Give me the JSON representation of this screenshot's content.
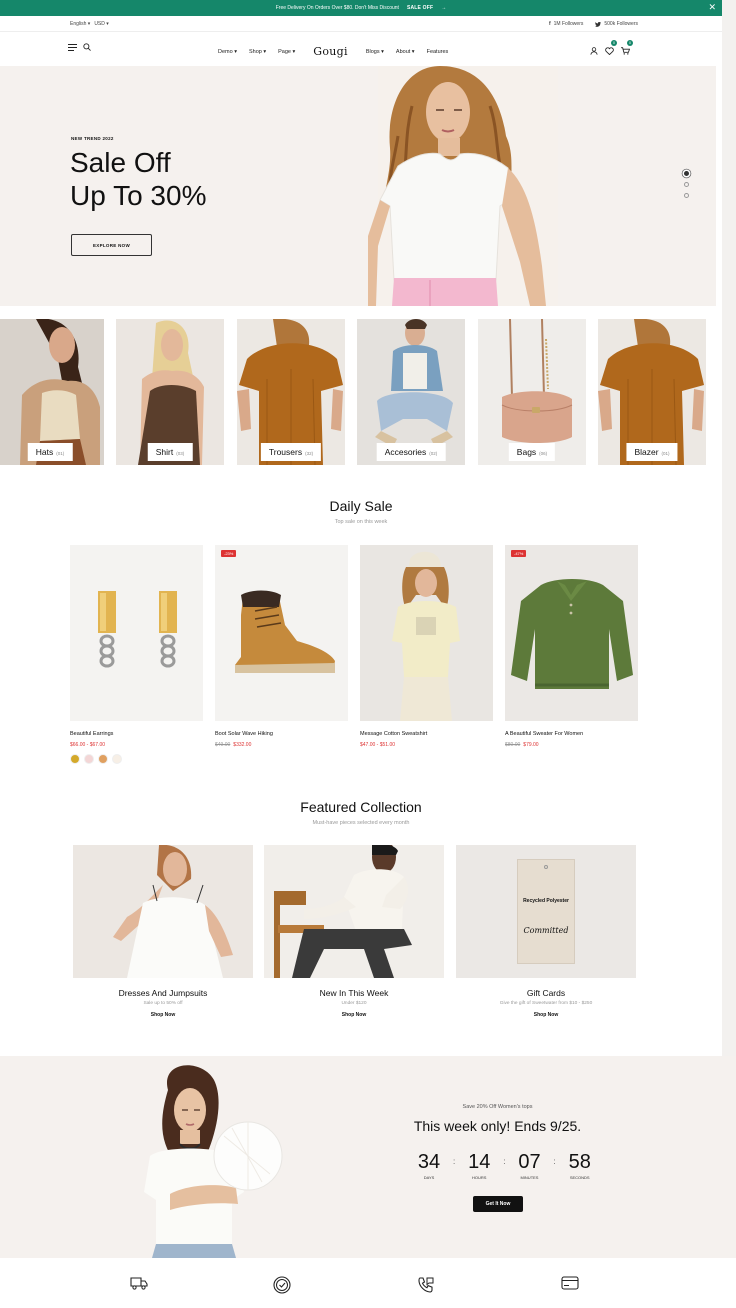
{
  "announcement": {
    "text": "Free Delivery On Orders Over $80. Don't Miss Discount",
    "cta": "SALE OFF",
    "arrow": "→",
    "close": "✕"
  },
  "topbar": {
    "language": "English",
    "currency": "USD",
    "facebook": "1M Followers",
    "twitter": "500k Followers"
  },
  "nav": {
    "logo": "Gougi",
    "menu": [
      "Demo",
      "Shop",
      "Page",
      "Blogs",
      "About",
      "Features"
    ],
    "wishlist_count": "0",
    "cart_count": "0"
  },
  "hero": {
    "eyebrow": "NEW TREND 2022",
    "line1": "Sale Off",
    "line2": "Up To 30%",
    "button": "EXPLORE NOW",
    "slides": 3,
    "active_slide": 1
  },
  "categories": [
    {
      "name": "Hats",
      "count": "(01)"
    },
    {
      "name": "Shirt",
      "count": "(03)"
    },
    {
      "name": "Trousers",
      "count": "(32)"
    },
    {
      "name": "Accesories",
      "count": "(02)"
    },
    {
      "name": "Bags",
      "count": "(06)"
    },
    {
      "name": "Blazer",
      "count": "(01)"
    }
  ],
  "daily_sale": {
    "title": "Daily Sale",
    "subtitle": "Top sale on this week",
    "products": [
      {
        "name": "Beautiful Earrings",
        "old_price": "",
        "price": "$66.00 - $67.00",
        "tag": "",
        "swatches": [
          "#d4a92a",
          "#f3d6d6",
          "#e0a060",
          "#f7efe6"
        ]
      },
      {
        "name": "Boot Solar Wave Hiking",
        "old_price": "$49.00",
        "price": "$332.00",
        "tag": "-23%"
      },
      {
        "name": "Message Cotton Sweatshirt",
        "old_price": "",
        "price": "$47.00 - $51.00",
        "tag": ""
      },
      {
        "name": "A Beautiful Sweater For Women",
        "old_price": "$80.00",
        "price": "$79.00",
        "tag": "-47%"
      }
    ]
  },
  "featured": {
    "title": "Featured Collection",
    "subtitle": "Must-have pieces selected every month",
    "items": [
      {
        "name": "Dresses And Jumpsuits",
        "sub": "Sale up to 50% off",
        "cta": "Shop Now"
      },
      {
        "name": "New In This Week",
        "sub": "Under $120",
        "cta": "Shop Now"
      },
      {
        "name": "Gift Cards",
        "sub": "Give the gift of Sweetwater from $10 - $250",
        "cta": "Shop Now",
        "card_title": "Recycled Polyester",
        "card_sign": "Committed"
      }
    ]
  },
  "promo": {
    "pretitle": "Save 20% Off Women's tops",
    "headline": "This week only! Ends 9/25.",
    "countdown": [
      {
        "value": "34",
        "label": "DAYS"
      },
      {
        "value": "14",
        "label": "HOURS"
      },
      {
        "value": "07",
        "label": "MINUTES"
      },
      {
        "value": "58",
        "label": "SECONDS"
      }
    ],
    "button": "Get It Now"
  },
  "features_bar": [
    "truck-icon",
    "badge-check-icon",
    "support-phone-icon",
    "credit-card-icon"
  ],
  "colors": {
    "brand": "#15876a",
    "sale": "#dd3333",
    "hero_bg": "#f5f1ee"
  }
}
